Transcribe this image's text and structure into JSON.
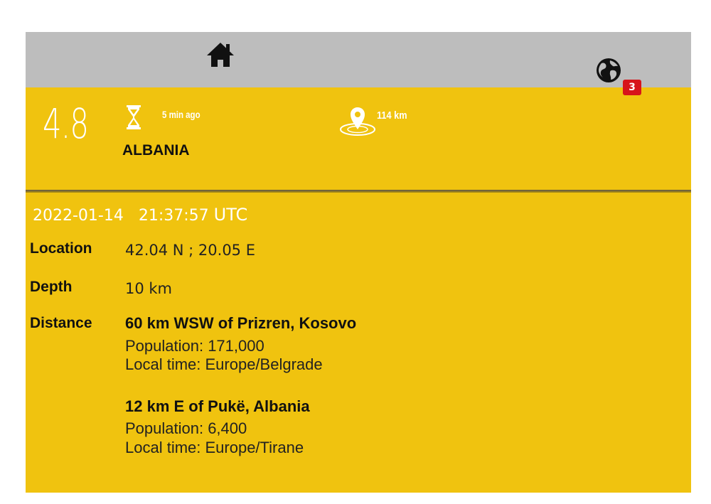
{
  "topbar": {
    "home_icon": "home-icon",
    "globe_icon": "globe-icon",
    "badge_count": "3"
  },
  "summary": {
    "magnitude": "4.8",
    "time_ago": "5 min ago",
    "region": "ALBANIA",
    "distance": "114 km",
    "hourglass_icon": "hourglass-icon",
    "location_pin_icon": "location-pin-icon"
  },
  "details": {
    "date": "2022-01-14",
    "time": "21:37:57",
    "timezone": "UTC",
    "location_label": "Location",
    "location_value": "42.04 N ; 20.05 E",
    "depth_label": "Depth",
    "depth_value": "10 km",
    "distance_label": "Distance",
    "places": [
      {
        "title": "60 km WSW of Prizren, Kosovo",
        "population": "Population: 171,000",
        "local_time": "Local time: Europe/Belgrade"
      },
      {
        "title": "12 km E of Pukë, Albania",
        "population": "Population: 6,400",
        "local_time": "Local time: Europe/Tirane"
      }
    ]
  },
  "colors": {
    "card_bg": "#f0c30f",
    "topbar_bg": "#bdbdbd",
    "badge_bg": "#d7141a"
  }
}
